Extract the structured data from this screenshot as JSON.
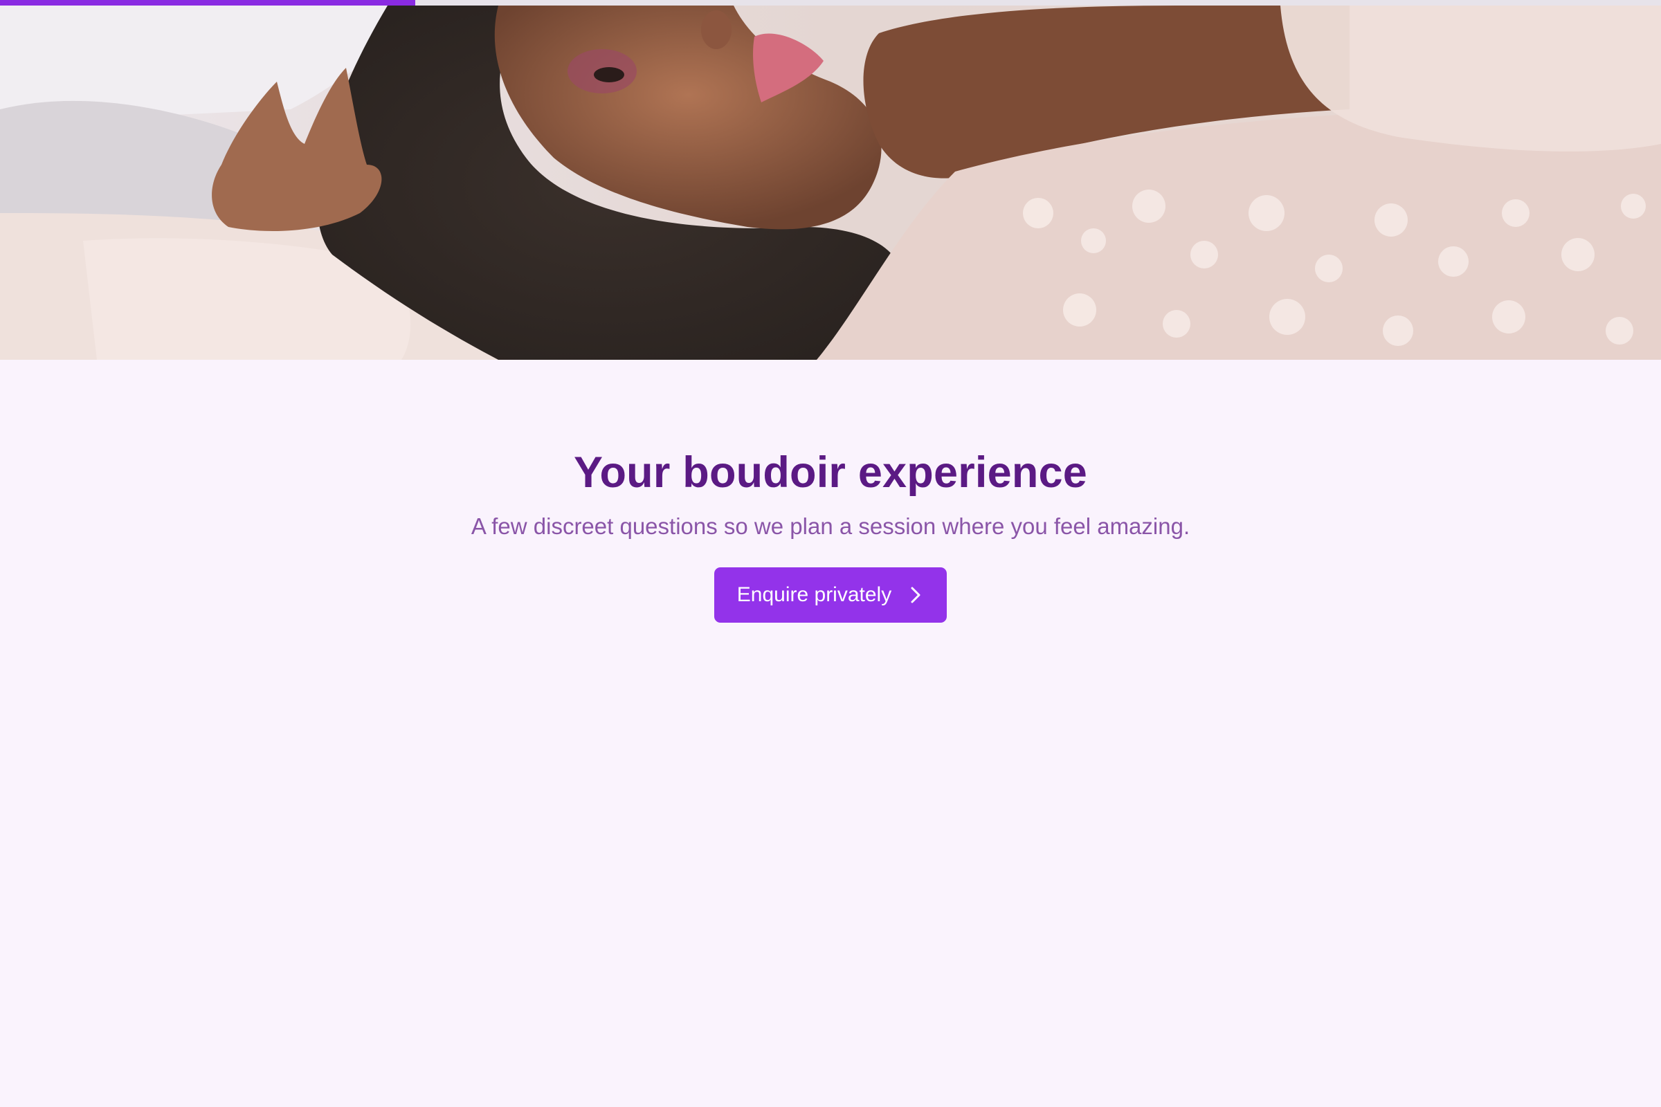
{
  "progress": {
    "fraction": 0.25,
    "fill_color": "#8a2be2",
    "track_color": "#e7e3ea"
  },
  "hero": {
    "image_alt": "hero-photo"
  },
  "intro": {
    "title": "Your boudoir experience",
    "subtitle": "A few discreet questions so we plan a session where you feel amazing.",
    "cta_label": "Enquire privately",
    "cta_icon": "chevron-right-icon"
  },
  "colors": {
    "background": "#faf3fd",
    "title": "#5b1a84",
    "subtitle": "#8a55a8",
    "accent": "#9333ea"
  }
}
